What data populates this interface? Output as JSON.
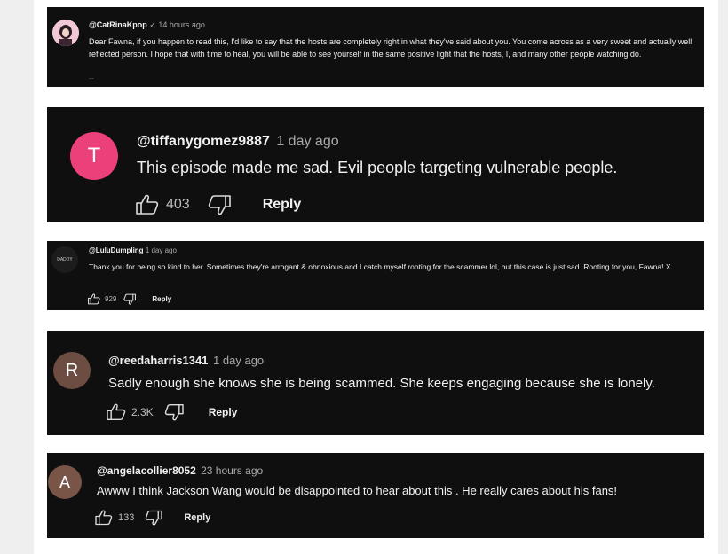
{
  "comments": [
    {
      "avatar_letter": "",
      "avatar_color": "#f6c6d6",
      "handle": "@CatRinaKpop",
      "verified_mark": "✓",
      "time": "14 hours ago",
      "text": "Dear Fawna, if you happen to read this, I'd like to say that the hosts are completely right in what they've said about you. You come across as a very sweet and actually well reflected person. I hope that with time to heal, you will be able to see yourself in the same positive light that the hosts, I, and many other people watching do.",
      "more": "..."
    },
    {
      "avatar_letter": "T",
      "avatar_color": "#ec407a",
      "handle": "@tiffanygomez9887",
      "time": "1 day ago",
      "text": "This episode made me sad. Evil people targeting vulnerable people.",
      "likes": "403",
      "reply_label": "Reply"
    },
    {
      "avatar_letter": "",
      "avatar_text": "DADDY",
      "avatar_color": "#1c1c1c",
      "handle": "@LuluDumpling",
      "time": "1 day ago",
      "text": "Thank you for being so kind to her. Sometimes they're arrogant & obnoxious and I catch myself rooting for the scammer lol, but this case is just sad. Rooting for you, Fawna! X",
      "likes": "929",
      "reply_label": "Reply"
    },
    {
      "avatar_letter": "R",
      "avatar_color": "#6d4c41",
      "handle": "@reedaharris1341",
      "time": "1 day ago",
      "text": "Sadly enough she knows she is being scammed. She keeps engaging because she is lonely.",
      "likes": "2.3K",
      "reply_label": "Reply"
    },
    {
      "avatar_letter": "A",
      "avatar_color": "#795548",
      "handle": "@angelacollier8052",
      "time": "23 hours ago",
      "text": "Awww I think Jackson Wang would be disappointed to hear about this . He really cares about his fans!",
      "likes": "133",
      "reply_label": "Reply"
    }
  ]
}
